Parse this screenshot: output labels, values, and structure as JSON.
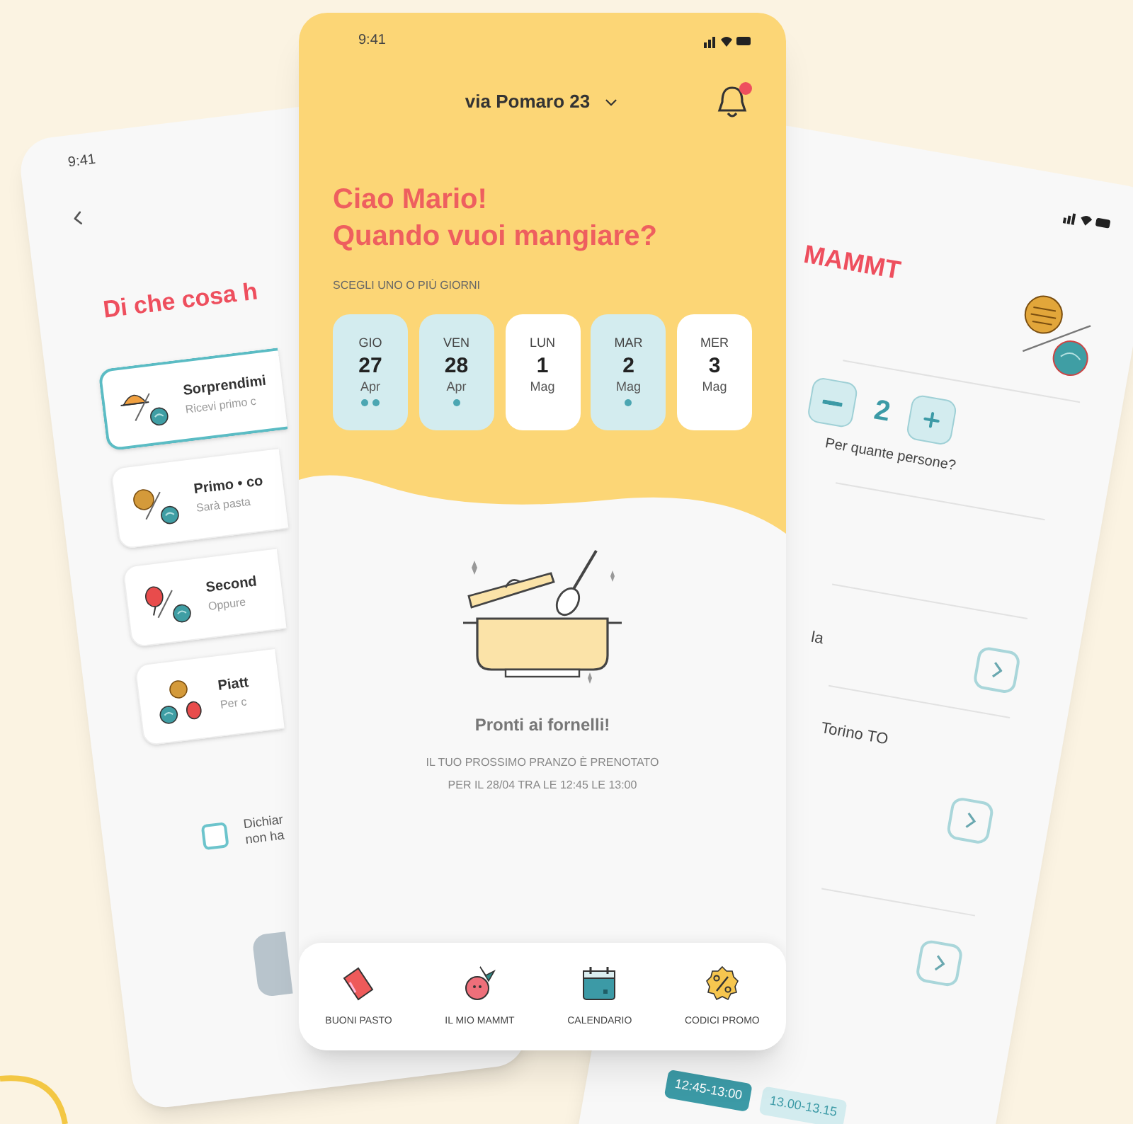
{
  "left_screen": {
    "time": "9:41",
    "title": "Di che cosa h",
    "options": [
      {
        "kind": "cloche",
        "title": "Sorprendimi",
        "subtitle": "Ricevi primo c",
        "selected": true
      },
      {
        "kind": "pasta",
        "title": "Primo • co",
        "subtitle": "Sarà pasta",
        "selected": false
      },
      {
        "kind": "meat",
        "title": "Second",
        "subtitle": "Oppure",
        "selected": false
      },
      {
        "kind": "combo",
        "title": "Piatt",
        "subtitle": "Per c",
        "selected": false
      }
    ],
    "declaration": {
      "lines": [
        "Dichiar",
        "non ha"
      ],
      "checked": false
    }
  },
  "main_screen": {
    "time": "9:41",
    "address": "via Pomaro 23",
    "unread_notifications": true,
    "greeting": [
      "Ciao Mario!",
      "Quando vuoi mangiare?"
    ],
    "days_label": "SCEGLI UNO O PIÙ GIORNI",
    "days": [
      {
        "weekday": "GIO",
        "day": "27",
        "month": "Apr",
        "selected": true,
        "dots": [
          {
            "color": "#4ba6b2"
          },
          {
            "color": "#4ba6b2"
          }
        ]
      },
      {
        "weekday": "VEN",
        "day": "28",
        "month": "Apr",
        "selected": true,
        "dots": [
          {
            "color": "#4ba6b2"
          }
        ]
      },
      {
        "weekday": "LUN",
        "day": "1",
        "month": "Mag",
        "selected": false
      },
      {
        "weekday": "MAR",
        "day": "2",
        "month": "Mag",
        "selected": true,
        "dots": [
          {
            "color": "#4ba6b2"
          }
        ]
      },
      {
        "weekday": "MER",
        "day": "3",
        "month": "Mag",
        "selected": false
      }
    ],
    "empty_state": {
      "title": "Pronti ai fornelli!",
      "lines": [
        "IL TUO PROSSIMO PRANZO È PRENOTATO",
        "PER IL 28/04 TRA LE 12:45 LE 13:00"
      ]
    },
    "nav": [
      {
        "kind": "vouchers",
        "label": "BUONI PASTO"
      },
      {
        "kind": "mammt",
        "label": "IL MIO MAMMT"
      },
      {
        "kind": "calendar",
        "label": "CALENDARIO"
      },
      {
        "kind": "promo",
        "label": "CODICI PROMO"
      }
    ]
  },
  "right_screen": {
    "title": "MAMMT",
    "quantity": "2",
    "quantity_label": "Per quante persone?",
    "address_lines": [
      "la",
      "Torino TO"
    ],
    "time_slots": [
      {
        "label": "12:45-13:00",
        "selected": true
      },
      {
        "label": "13.00-13.15",
        "selected": false
      }
    ]
  }
}
